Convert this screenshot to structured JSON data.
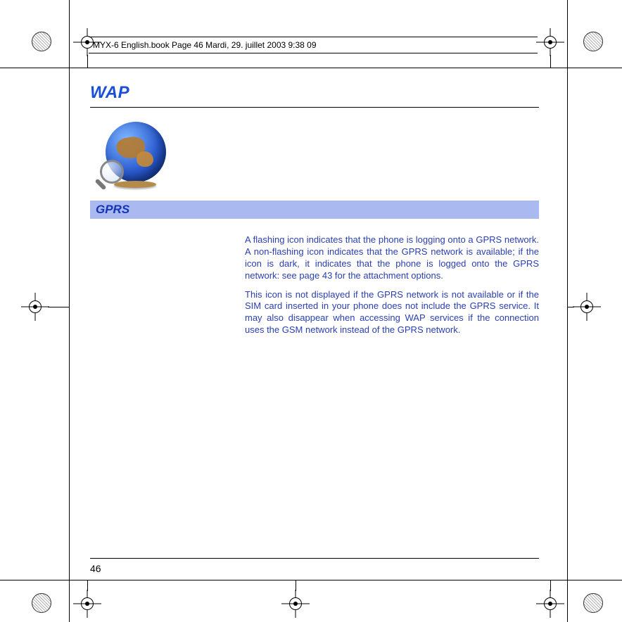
{
  "header": {
    "meta_line": "MYX-6 English.book  Page 46  Mardi, 29. juillet 2003  9:38 09"
  },
  "page": {
    "title": "WAP",
    "section_heading": "GPRS",
    "paragraph1": "A flashing icon indicates that the phone is logging onto a GPRS network. A non-flashing icon indicates that the GPRS network is available; if the icon is dark, it indicates that the phone is logged onto the GPRS network: see page 43 for the attachment options.",
    "paragraph2": "This icon is not displayed if the GPRS network is not available or if the SIM card inserted in your phone does not include the GPRS service. It may also disappear when accessing WAP services if the connection uses the GSM network instead of the GPRS network.",
    "number": "46"
  }
}
